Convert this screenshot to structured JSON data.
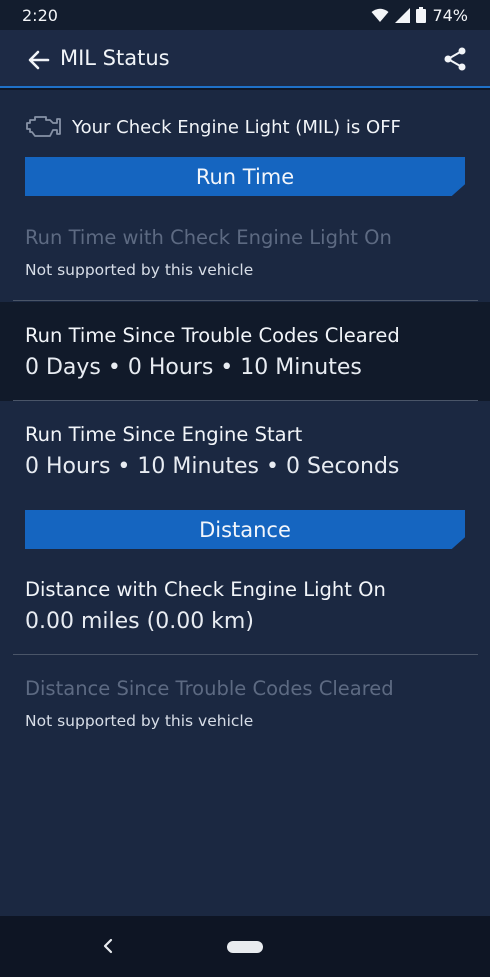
{
  "status_bar": {
    "time": "2:20",
    "battery": "74%"
  },
  "app_bar": {
    "title": "MIL Status"
  },
  "mil": {
    "text": "Your Check Engine Light (MIL) is OFF"
  },
  "sections": {
    "run_time": "Run Time",
    "distance": "Distance"
  },
  "run_time_items": {
    "cel_on": {
      "title": "Run Time with Check Engine Light On",
      "sub": "Not supported by this vehicle"
    },
    "since_cleared": {
      "title": "Run Time Since Trouble Codes Cleared",
      "value": "0 Days • 0 Hours • 10 Minutes"
    },
    "since_start": {
      "title": "Run Time Since Engine Start",
      "value": "0 Hours • 10 Minutes • 0 Seconds"
    }
  },
  "distance_items": {
    "cel_on": {
      "title": "Distance with Check Engine Light On",
      "value": "0.00 miles (0.00 km)"
    },
    "since_cleared": {
      "title": "Distance Since Trouble Codes Cleared",
      "sub": "Not supported by this vehicle"
    }
  },
  "colors": {
    "accent": "#1565c0",
    "background": "#1b2841",
    "app_bar": "#1d2a45"
  }
}
